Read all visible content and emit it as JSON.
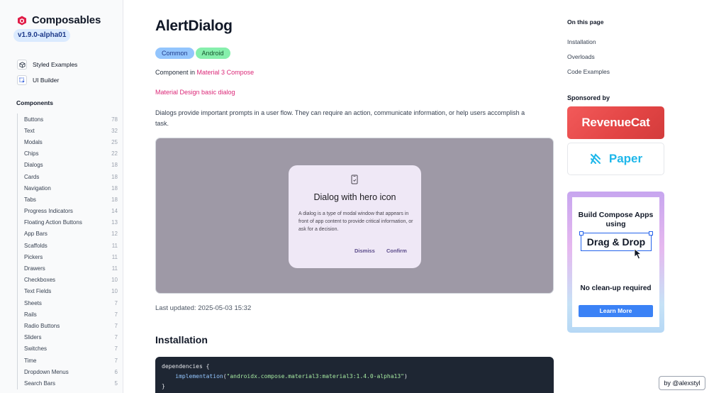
{
  "brand": {
    "name": "Composables",
    "version": "v1.9.0-alpha01"
  },
  "sidebar": {
    "links": [
      {
        "label": "Styled Examples",
        "icon": "cube-icon"
      },
      {
        "label": "UI Builder",
        "icon": "cursor-select-icon"
      }
    ],
    "components_heading": "Components",
    "components": [
      {
        "label": "Buttons",
        "count": "78"
      },
      {
        "label": "Text",
        "count": "32"
      },
      {
        "label": "Modals",
        "count": "25"
      },
      {
        "label": "Chips",
        "count": "22"
      },
      {
        "label": "Dialogs",
        "count": "18"
      },
      {
        "label": "Cards",
        "count": "18"
      },
      {
        "label": "Navigation",
        "count": "18"
      },
      {
        "label": "Tabs",
        "count": "18"
      },
      {
        "label": "Progress Indicators",
        "count": "14"
      },
      {
        "label": "Floating Action Buttons",
        "count": "13"
      },
      {
        "label": "App Bars",
        "count": "12"
      },
      {
        "label": "Scaffolds",
        "count": "11"
      },
      {
        "label": "Pickers",
        "count": "11"
      },
      {
        "label": "Drawers",
        "count": "11"
      },
      {
        "label": "Checkboxes",
        "count": "10"
      },
      {
        "label": "Text Fields",
        "count": "10"
      },
      {
        "label": "Sheets",
        "count": "7"
      },
      {
        "label": "Rails",
        "count": "7"
      },
      {
        "label": "Radio Buttons",
        "count": "7"
      },
      {
        "label": "Sliders",
        "count": "7"
      },
      {
        "label": "Switches",
        "count": "7"
      },
      {
        "label": "Time",
        "count": "7"
      },
      {
        "label": "Dropdown Menus",
        "count": "6"
      },
      {
        "label": "Search Bars",
        "count": "5"
      }
    ]
  },
  "main": {
    "title": "AlertDialog",
    "tags": [
      "Common",
      "Android"
    ],
    "component_in_prefix": "Component in ",
    "component_in_link": "Material 3 Compose",
    "md_link": "Material Design basic dialog",
    "description": "Dialogs provide important prompts in a user flow. They can require an action, communicate information, or help users accomplish a task.",
    "preview": {
      "dialog_title": "Dialog with hero icon",
      "dialog_text": "A dialog is a type of modal window that appears in front of app content to provide critical information, or ask for a decision.",
      "dismiss": "Dismiss",
      "confirm": "Confirm"
    },
    "last_updated": "Last updated: 2025-05-03 15:32",
    "installation_heading": "Installation",
    "code": {
      "line1": "dependencies {",
      "line2_fn": "implementation",
      "line2_arg": "\"androidx.compose.material3:material3:1.4.0-alpha13\"",
      "line3": "}"
    }
  },
  "toc": {
    "title": "On this page",
    "items": [
      "Installation",
      "Overloads",
      "Code Examples"
    ]
  },
  "sponsors": {
    "heading": "Sponsored by",
    "revenuecat": "RevenueCat",
    "paper": "Paper",
    "ad": {
      "line1": "Build Compose Apps",
      "line2": "using",
      "highlight": "Drag & Drop",
      "tagline": "No clean-up required",
      "button": "Learn More"
    }
  },
  "credit": "by @alexstyl",
  "colors": {
    "accent_pink": "#db2777",
    "preview_bg": "#9e99a6",
    "dialog_bg": "#efe8f6",
    "code_bg": "#1e2633"
  }
}
